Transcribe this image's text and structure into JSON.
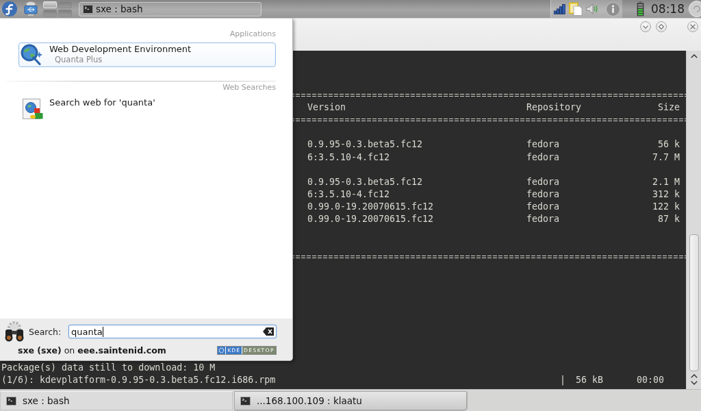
{
  "top_panel": {
    "pager": [
      {
        "selected": true
      },
      {
        "selected": false
      },
      {
        "selected": false
      },
      {
        "selected": false
      }
    ],
    "task": {
      "label": "sxe : bash"
    },
    "clock": "08:18"
  },
  "terminal": {
    "header": {
      "version": "Version",
      "repository": "Repository",
      "size": "Size"
    },
    "groups": [
      {
        "rows": [
          {
            "version": "0.9.95-0.3.beta5.fc12",
            "repository": "fedora",
            "size": "56 k"
          },
          {
            "version": "6:3.5.10-4.fc12",
            "repository": "fedora",
            "size": "7.7 M"
          }
        ]
      },
      {
        "rows": [
          {
            "version": "0.9.95-0.3.beta5.fc12",
            "repository": "fedora",
            "size": "2.1 M"
          },
          {
            "version": "6:3.5.10-4.fc12",
            "repository": "fedora",
            "size": "312 k"
          },
          {
            "version": "0.99.0-19.20070615.fc12",
            "repository": "fedora",
            "size": "122 k"
          },
          {
            "version": "0.99.0-19.20070615.fc12",
            "repository": "fedora",
            "size": "87 k"
          }
        ]
      }
    ],
    "download": {
      "summary": "Package(s) data still to download: 10 M",
      "file": "(1/6): kdevplatform-0.9.95-0.3.beta5.fc12.i686.rpm",
      "separator": "|",
      "size": "56 kB",
      "time": "00:00"
    }
  },
  "launcher_menu": {
    "sections": [
      {
        "title": "Applications",
        "items": [
          {
            "kind": "application",
            "title": "Web Development Environment",
            "subtitle": "Quanta Plus",
            "selected": true
          }
        ]
      },
      {
        "title": "Web Searches",
        "items": [
          {
            "kind": "web-search",
            "title": "Search web for 'quanta'",
            "selected": false
          }
        ]
      }
    ],
    "search": {
      "label": "Search:",
      "value": "quanta"
    },
    "user_line": "**sxe (sxe)** on **eee.saintenid.com**",
    "badge": {
      "left": "KDE",
      "right": "DESKTOP"
    }
  },
  "bottom_panel": {
    "tasks": [
      {
        "label": "sxe : bash",
        "selected": true
      },
      {
        "label": "...168.100.109 : klaatu",
        "selected": false
      }
    ]
  }
}
